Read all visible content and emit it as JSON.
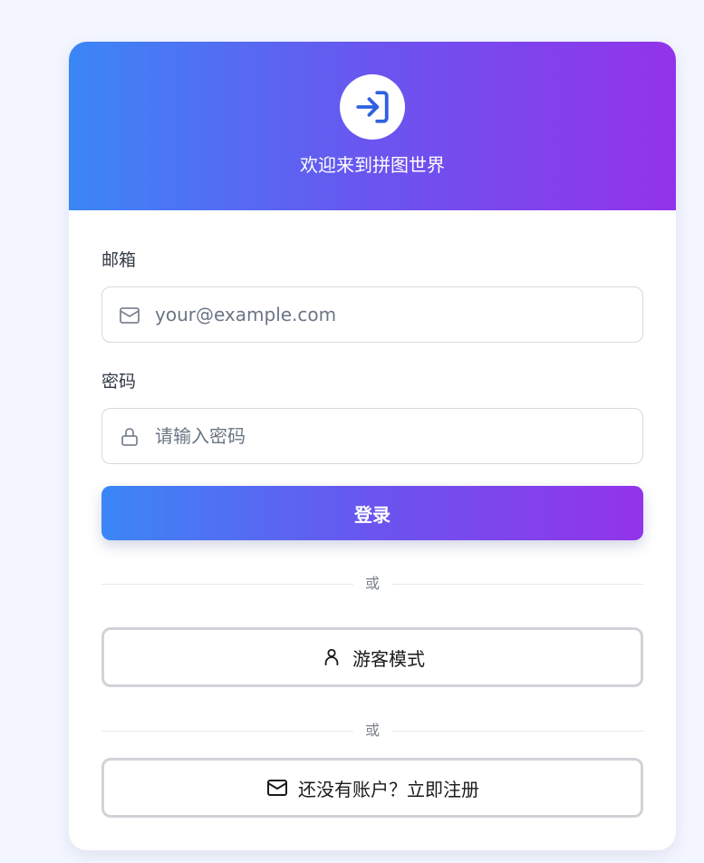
{
  "header": {
    "title": "欢迎来到拼图世界",
    "icon": "sign-in-icon"
  },
  "form": {
    "email": {
      "label": "邮箱",
      "placeholder": "your@example.com",
      "value": "",
      "icon": "mail-icon"
    },
    "password": {
      "label": "密码",
      "placeholder": "请输入密码",
      "value": "",
      "icon": "lock-icon"
    },
    "submit_label": "登录"
  },
  "divider_text": "或",
  "guest_button": {
    "label": "游客模式",
    "icon": "user-icon"
  },
  "register_button": {
    "label": "还没有账户？立即注册",
    "icon": "mail-icon"
  },
  "colors": {
    "gradient_start": "#3b86f6",
    "gradient_end": "#9333ea",
    "page_background": "#f3f6ff"
  }
}
